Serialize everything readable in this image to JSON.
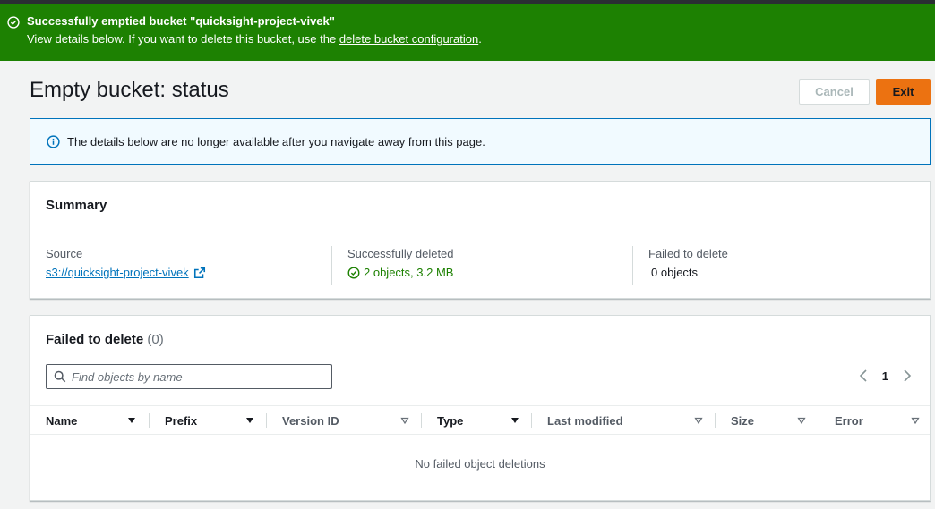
{
  "flash": {
    "title": "Successfully emptied bucket \"quicksight-project-vivek\"",
    "description_prefix": "View details below. If you want to delete this bucket, use the ",
    "link_text": "delete bucket configuration",
    "description_suffix": ".",
    "icon": "check-circle-icon",
    "color": "#1d8102"
  },
  "page": {
    "title": "Empty bucket: status",
    "cancel_label": "Cancel",
    "exit_label": "Exit"
  },
  "info": {
    "text": "The details below are no longer available after you navigate away from this page.",
    "icon": "info-icon"
  },
  "summary": {
    "title": "Summary",
    "source_label": "Source",
    "source_value": "s3://quicksight-project-vivek",
    "deleted_label": "Successfully deleted",
    "deleted_value": "2 objects, 3.2 MB",
    "failed_label": "Failed to delete",
    "failed_value": "0 objects"
  },
  "failed": {
    "title": "Failed to delete",
    "count": "(0)",
    "search_placeholder": "Find objects by name",
    "page_number": "1",
    "columns": [
      "Name",
      "Prefix",
      "Version ID",
      "Type",
      "Last modified",
      "Size",
      "Error"
    ],
    "empty_text": "No failed object deletions"
  },
  "colors": {
    "accent": "#ec7211",
    "link": "#0073bb",
    "success": "#1d8102"
  }
}
